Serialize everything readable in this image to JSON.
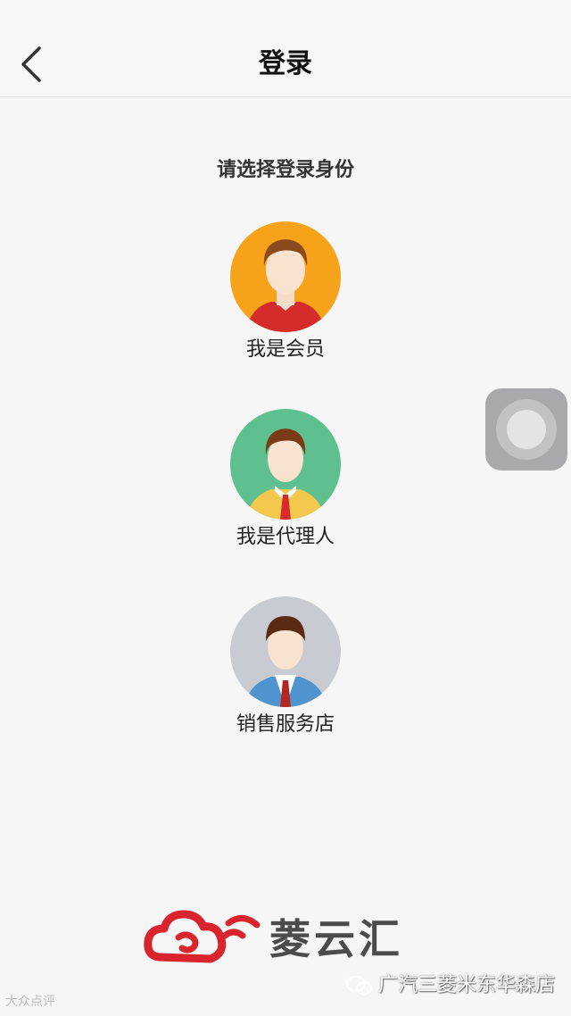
{
  "header": {
    "title": "登录",
    "back_icon": "chevron-left-icon"
  },
  "prompt": "请选择登录身份",
  "roles": [
    {
      "label": "我是会员",
      "avatar_bg": "#f7a21b",
      "shirt": "#d62b2b",
      "hair": "#8a4a1e"
    },
    {
      "label": "我是代理人",
      "avatar_bg": "#5ec08e",
      "shirt": "#f2c94c",
      "hair": "#7a3a16"
    },
    {
      "label": "销售服务店",
      "avatar_bg": "#c8ccd2",
      "shirt": "#4f94cf",
      "hair": "#5a2a12"
    }
  ],
  "floating_button": {
    "icon": "assistive-touch-icon"
  },
  "footer": {
    "brand_name": "菱云汇",
    "brand_logo": "cloud-signal-logo",
    "brand_color": "#d9232d",
    "watermark_left": "大众点评",
    "watermark_right": "广汽三菱米东华森店"
  }
}
